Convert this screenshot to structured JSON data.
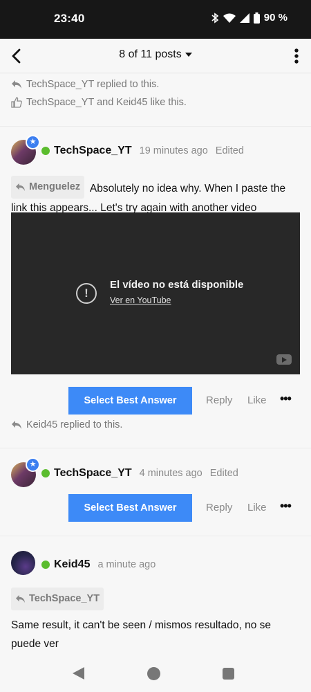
{
  "status_bar": {
    "time": "23:40",
    "battery": "90 %"
  },
  "topbar": {
    "posts_nav": "8 of 11 posts"
  },
  "post_top": {
    "replied_line": "TechSpace_YT replied to this.",
    "likes_line": "TechSpace_YT and Keid45 like this."
  },
  "post1": {
    "username": "TechSpace_YT",
    "time": "19 minutes ago",
    "edited": "Edited",
    "quote_user": "Menguelez",
    "text": "Absolutely no idea why. When I paste the link this appears... Let's try again with another video",
    "video": {
      "title": "El vídeo no está disponible",
      "link": "Ver en YouTube"
    },
    "best_answer": "Select Best Answer",
    "reply": "Reply",
    "like": "Like",
    "more": "•••",
    "replied_line": "Keid45 replied to this."
  },
  "post2": {
    "username": "TechSpace_YT",
    "time": "4 minutes ago",
    "edited": "Edited",
    "best_answer": "Select Best Answer",
    "reply": "Reply",
    "like": "Like",
    "more": "•••"
  },
  "post3": {
    "username": "Keid45",
    "time": "a minute ago",
    "quote_user": "TechSpace_YT",
    "text": "Same result, it can't be seen / mismos resultado, no se puede ver"
  },
  "colors": {
    "accent": "#3d8af7",
    "online": "#5bbc2e",
    "badge": "#3d7ff0"
  }
}
